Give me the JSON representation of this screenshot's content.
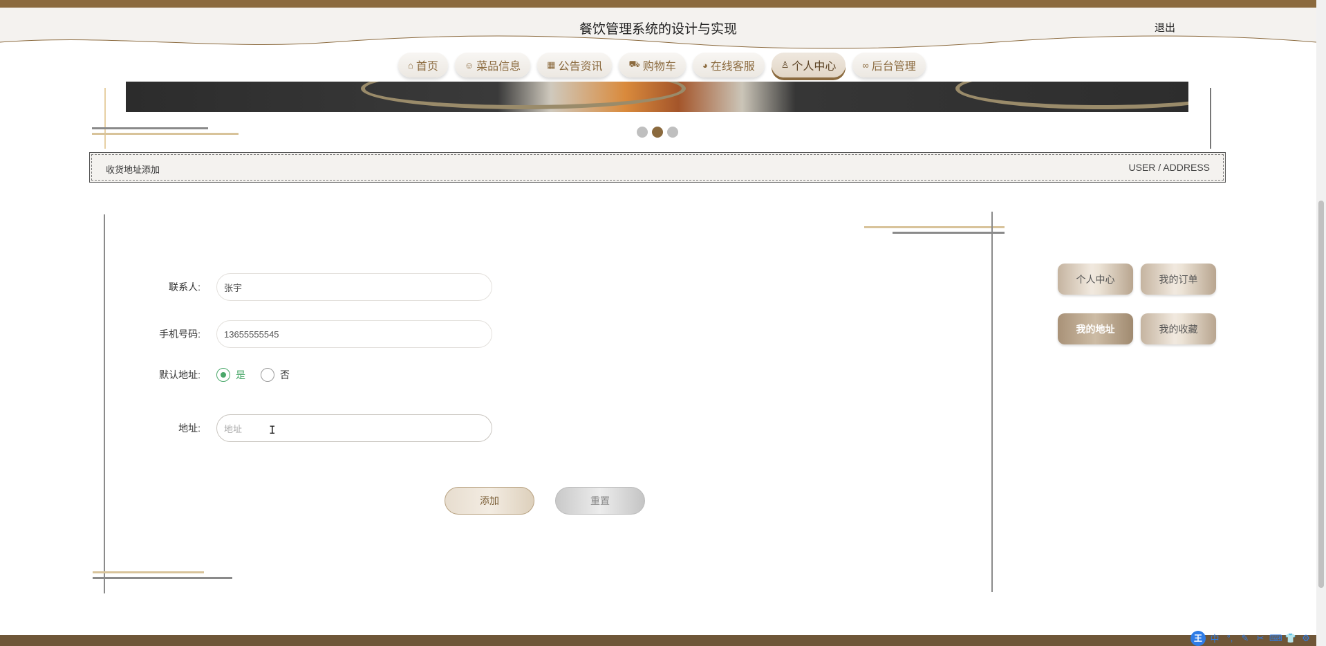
{
  "header": {
    "title": "餐饮管理系统的设计与实现",
    "logout_label": "退出"
  },
  "nav": {
    "items": [
      {
        "icon": "home-icon",
        "glyph": "⌂",
        "label": "首页"
      },
      {
        "icon": "dish-icon",
        "glyph": "☺",
        "label": "菜品信息"
      },
      {
        "icon": "gift-icon",
        "glyph": "▦",
        "label": "公告资讯"
      },
      {
        "icon": "cart-icon",
        "glyph": "⛟",
        "label": "购物车"
      },
      {
        "icon": "service-icon",
        "glyph": "◕",
        "label": "在线客服"
      },
      {
        "icon": "user-icon",
        "glyph": "♙",
        "label": "个人中心"
      },
      {
        "icon": "link-icon",
        "glyph": "∞",
        "label": "后台管理"
      }
    ],
    "active_index": 5
  },
  "carousel": {
    "dot_count": 3,
    "active_dot": 1
  },
  "breadcrumb": {
    "title": "收货地址添加",
    "path": "USER / ADDRESS"
  },
  "form": {
    "contact_label": "联系人:",
    "contact_value": "张宇",
    "phone_label": "手机号码:",
    "phone_value": "13655555545",
    "default_label": "默认地址:",
    "default_yes": "是",
    "default_no": "否",
    "default_selected": "是",
    "address_label": "地址:",
    "address_placeholder": "地址",
    "add_button": "添加",
    "reset_button": "重置"
  },
  "side_menu": {
    "items": [
      {
        "label": "个人中心",
        "active": false
      },
      {
        "label": "我的订单",
        "active": false
      },
      {
        "label": "我的地址",
        "active": true
      },
      {
        "label": "我的收藏",
        "active": false
      }
    ]
  },
  "ime": {
    "logo": "王",
    "items": [
      "中",
      "°,",
      "✎",
      "✂",
      "⌨",
      "👕",
      "⚙"
    ]
  },
  "colors": {
    "brand": "#8b6a3e",
    "accent_green": "#4aa86a",
    "header_bg": "#f4f2ef",
    "footer": "#6f5638"
  }
}
